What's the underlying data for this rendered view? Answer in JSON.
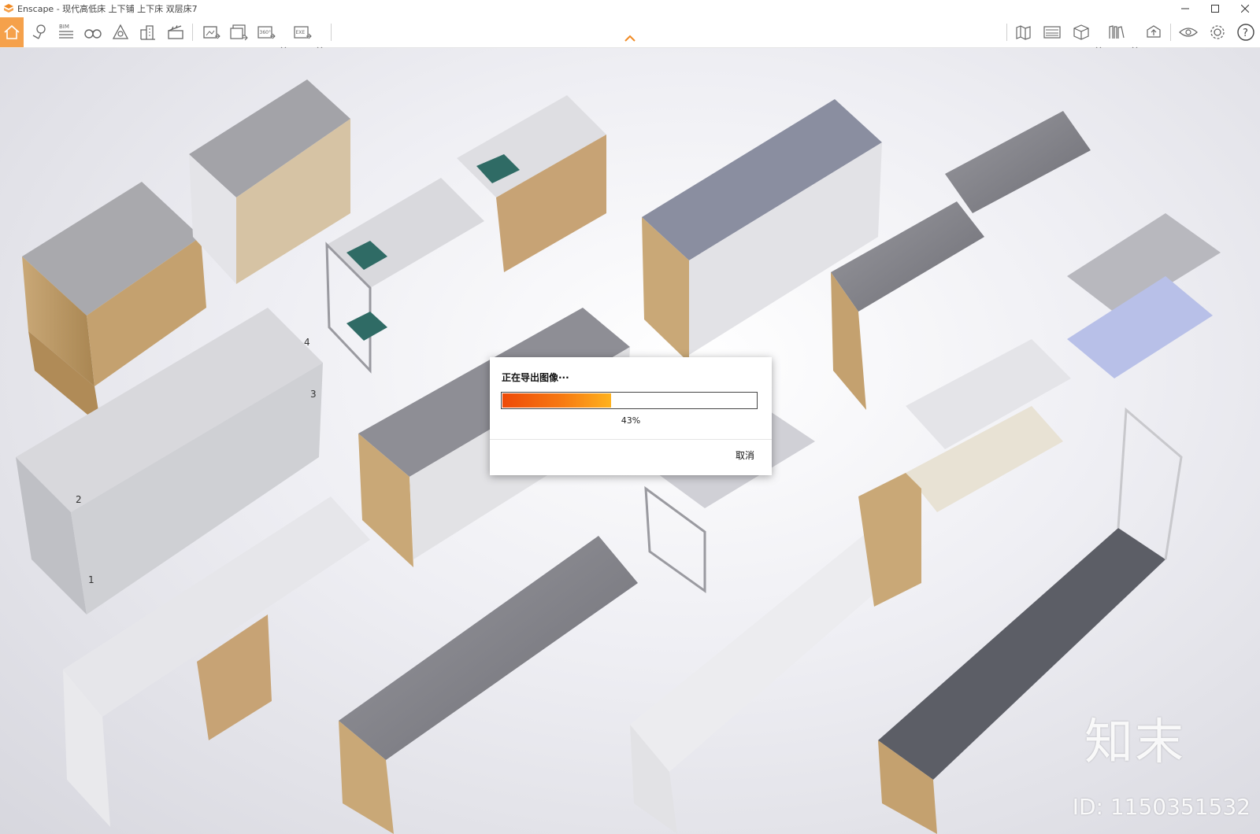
{
  "window": {
    "app_name": "Enscape",
    "title": "Enscape - 现代高低床 上下铺 上下床 双层床7",
    "controls": [
      "minimize-icon",
      "maximize-icon",
      "close-icon"
    ]
  },
  "toolbar": {
    "left_icons": [
      "home-icon",
      "location-pin-icon",
      "bim-icon",
      "binoculars-icon",
      "asset-library-icon",
      "buildings-icon",
      "clapperboard-icon",
      "screenshot-export-icon",
      "batch-export-icon",
      "panorama-export-icon",
      "exe-export-icon"
    ],
    "bim_label": "BIM",
    "panorama_label": "360°",
    "exe_label": "EXE",
    "right_icons": [
      "map-icon",
      "video-editor-icon",
      "box-view-icon",
      "books-icon",
      "cloud-upload-icon",
      "eye-icon",
      "settings-icon",
      "help-icon"
    ],
    "accent_color": "#f5a14b"
  },
  "scene": {
    "watermark_logo": "知末",
    "watermark_id": "ID: 1150351532",
    "bed_markers": [
      "1",
      "2",
      "3",
      "4"
    ]
  },
  "dialog": {
    "title": "正在导出图像···",
    "progress_fraction": 0.43,
    "progress_text": "43%",
    "cancel_label": "取消"
  }
}
